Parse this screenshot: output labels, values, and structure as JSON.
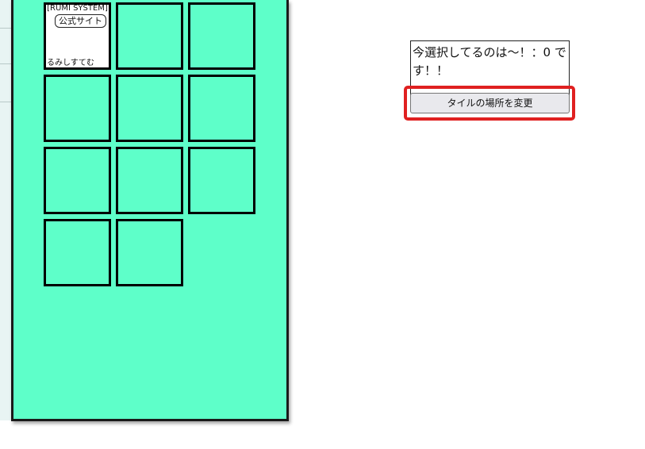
{
  "tiles": {
    "first": {
      "caption": "[RUMI SYSTEM]",
      "link_label": "公式サイト",
      "name": "るみしすてむ"
    },
    "count": 11
  },
  "info": {
    "line": "今選択してるのは〜！：0 です！！"
  },
  "button": {
    "change_label": "タイルの場所を変更"
  },
  "colors": {
    "panel_bg": "#5effc9",
    "highlight": "#e02020"
  }
}
